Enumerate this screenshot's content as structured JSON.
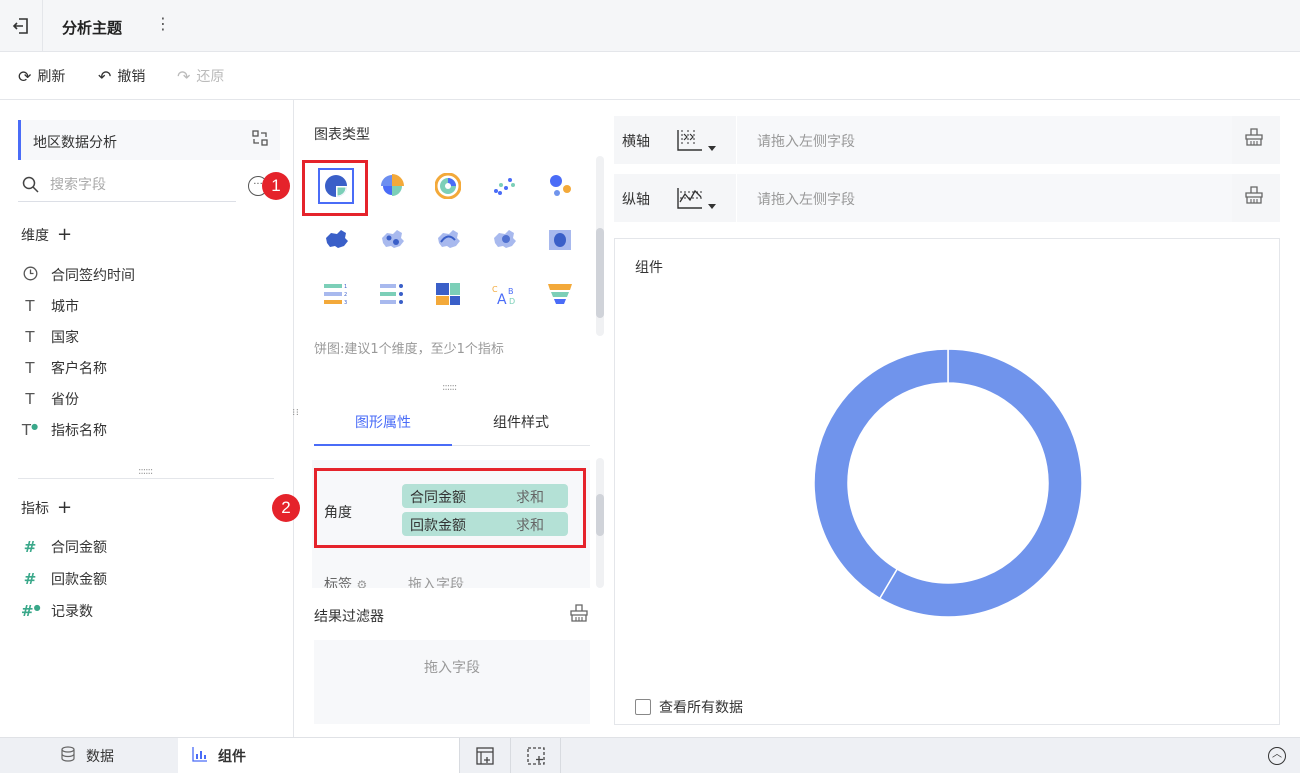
{
  "header": {
    "title": "分析主题",
    "back_icon": "exit-icon",
    "menu_glyph": "⋮"
  },
  "toolbar": {
    "refresh": "刷新",
    "undo": "撤销",
    "redo": "还原"
  },
  "left": {
    "dataset_name": "地区数据分析",
    "search_placeholder": "搜索字段",
    "dimensions_header": "维度",
    "dimensions": [
      {
        "label": "合同签约时间",
        "type": "date"
      },
      {
        "label": "城市",
        "type": "text"
      },
      {
        "label": "国家",
        "type": "text"
      },
      {
        "label": "客户名称",
        "type": "text"
      },
      {
        "label": "省份",
        "type": "text"
      },
      {
        "label": "指标名称",
        "type": "text-calc"
      }
    ],
    "metrics_header": "指标",
    "metrics": [
      {
        "label": "合同金额",
        "type": "number"
      },
      {
        "label": "回款金额",
        "type": "number"
      },
      {
        "label": "记录数",
        "type": "number-calc"
      }
    ]
  },
  "middle": {
    "chart_type_label": "图表类型",
    "chart_types": [
      "pie",
      "rose-pie",
      "sunburst-pie",
      "scatter",
      "bubble",
      "area-map",
      "point-map",
      "flow-map",
      "heat-map",
      "custom-map",
      "ranking-table",
      "ranking-list",
      "treemap",
      "word-cloud",
      "funnel"
    ],
    "selected_chart": "pie",
    "hint": "饼图:建议1个维度，至少1个指标",
    "tabs": [
      "图形属性",
      "组件样式"
    ],
    "active_tab": 0,
    "angle_label": "角度",
    "angle_fields": [
      {
        "name": "合同金额",
        "agg": "求和"
      },
      {
        "name": "回款金额",
        "agg": "求和"
      }
    ],
    "label_row": "标签",
    "label_drop": "拖入字段",
    "filter_header": "结果过滤器",
    "filter_drop": "拖入字段",
    "badges": [
      "1",
      "2"
    ]
  },
  "right": {
    "x_axis_label": "横轴",
    "y_axis_label": "纵轴",
    "axis_placeholder": "请拖入左侧字段",
    "canvas_title": "组件",
    "view_all": "查看所有数据",
    "donut_color": "#7094ec",
    "donut_segments": [
      0.585,
      0.415
    ]
  },
  "bottom": {
    "data_tab": "数据",
    "component_tab": "组件"
  }
}
